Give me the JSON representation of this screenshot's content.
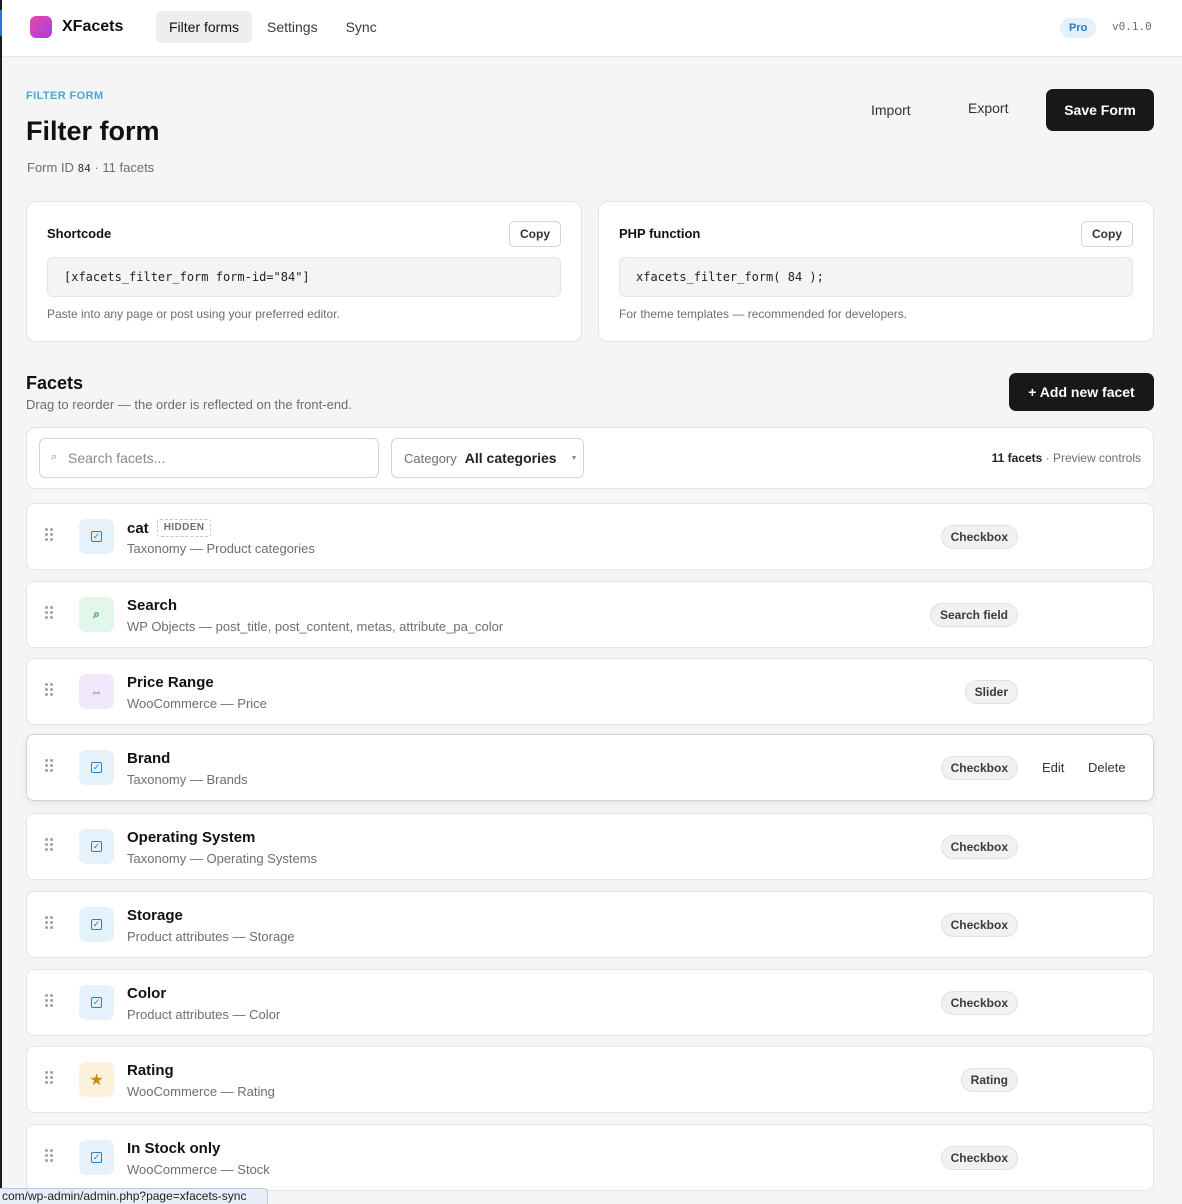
{
  "app": {
    "name": "XFacets",
    "badge": "Pro",
    "version": "v0.1.0"
  },
  "nav": {
    "tabs": [
      {
        "label": "Filter forms",
        "active": true
      },
      {
        "label": "Settings",
        "active": false
      },
      {
        "label": "Sync",
        "active": false
      }
    ]
  },
  "header": {
    "eyebrow": "FILTER FORM",
    "title": "Filter form",
    "form_id_label": "Form ID",
    "form_id": "84",
    "facet_summary": "· 11 facets",
    "import_label": "Import",
    "export_label": "Export",
    "save_label": "Save Form"
  },
  "shortcode": {
    "title": "Shortcode",
    "copy_label": "Copy",
    "code": "[xfacets_filter_form form-id=\"84\"]",
    "help": "Paste into any page or post using your preferred editor."
  },
  "php": {
    "title": "PHP function",
    "copy_label": "Copy",
    "code": "xfacets_filter_form( 84 );",
    "help": "For theme templates — recommended for developers."
  },
  "facets": {
    "title": "Facets",
    "subtitle": "Drag to reorder — the order is reflected on the front-end.",
    "add_label": "+ Add new facet",
    "search_placeholder": "Search facets...",
    "category_label": "Category",
    "category_value": "All categories",
    "count_bold": "11 facets",
    "count_rest": " · Preview controls",
    "edit_label": "Edit",
    "delete_label": "Delete",
    "items": [
      {
        "name": "cat",
        "badge": "HIDDEN",
        "desc": "Taxonomy — Product categories",
        "type": "Checkbox",
        "icon": "checkbox-icon"
      },
      {
        "name": "Search",
        "desc": "WP Objects — post_title, post_content, metas, attribute_pa_color",
        "type": "Search field",
        "icon": "search-icon"
      },
      {
        "name": "Price Range",
        "desc": "WooCommerce — Price",
        "type": "Slider",
        "icon": "slider-icon"
      },
      {
        "name": "Brand",
        "desc": "Taxonomy — Brands",
        "type": "Checkbox",
        "icon": "checkbox-icon"
      },
      {
        "name": "Operating System",
        "desc": "Taxonomy — Operating Systems",
        "type": "Checkbox",
        "icon": "checkbox-icon"
      },
      {
        "name": "Storage",
        "desc": "Product attributes — Storage",
        "type": "Checkbox",
        "icon": "checkbox-icon"
      },
      {
        "name": "Color",
        "desc": "Product attributes — Color",
        "type": "Checkbox",
        "icon": "checkbox-icon"
      },
      {
        "name": "Rating",
        "desc": "WooCommerce — Rating",
        "type": "Rating",
        "icon": "star-icon"
      },
      {
        "name": "In Stock only",
        "desc": "WooCommerce — Stock",
        "type": "Checkbox",
        "icon": "checkbox-icon"
      }
    ]
  },
  "status_bar": {
    "url": "com/wp-admin/admin.php?page=xfacets-sync"
  }
}
